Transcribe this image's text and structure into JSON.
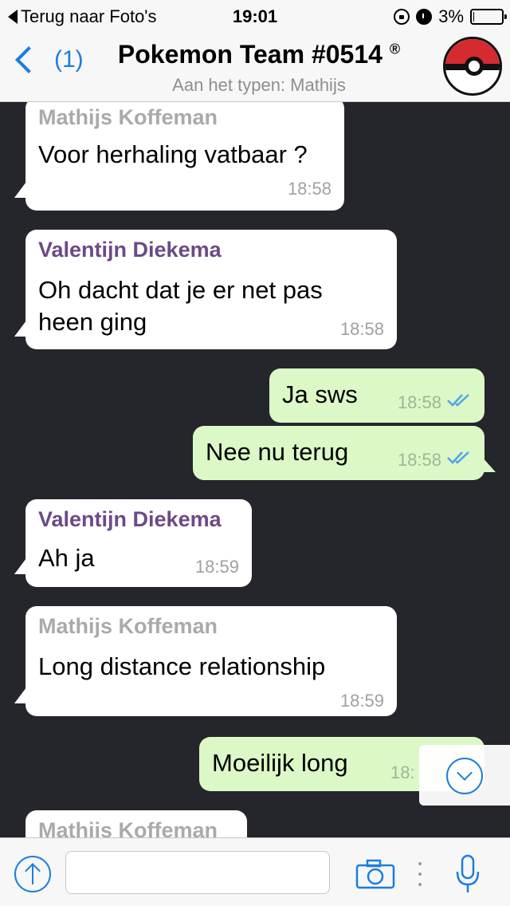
{
  "status": {
    "back_label": "Terug naar Foto's",
    "time": "19:01",
    "battery": "3%",
    "battery_level": 0.03
  },
  "header": {
    "back_count": "(1)",
    "title": "Pokemon Team #0514",
    "title_mark": "®",
    "subtitle": "Aan het typen: Mathijs"
  },
  "messages": [
    {
      "sender": "Mathijs Koffeman",
      "text": "Voor herhaling vatbaar ?",
      "time": "18:58"
    },
    {
      "sender": "Valentijn Diekema",
      "text1": "Oh dacht dat je er net pas",
      "text2": "heen ging",
      "time": "18:58"
    },
    {
      "text": "Ja sws",
      "time": "18:58"
    },
    {
      "text": "Nee nu terug",
      "time": "18:58"
    },
    {
      "sender": "Valentijn Diekema",
      "text": "Ah ja",
      "time": "18:59"
    },
    {
      "sender": "Mathijs Koffeman",
      "text": "Long distance relationship",
      "time": "18:59"
    },
    {
      "text": "Moeilijk long",
      "time": "18:"
    },
    {
      "sender": "Mathijs Koffeman"
    }
  ],
  "input": {
    "placeholder": ""
  },
  "colors": {
    "accent": "#1a7ee0",
    "chat_bg": "#25252c",
    "incoming_bubble": "#ffffff",
    "outgoing_bubble": "#dcf8c6",
    "sender_grey": "#aaaaaa",
    "sender_purple": "#6b4a86",
    "read_ticks": "#4fa5e8"
  }
}
